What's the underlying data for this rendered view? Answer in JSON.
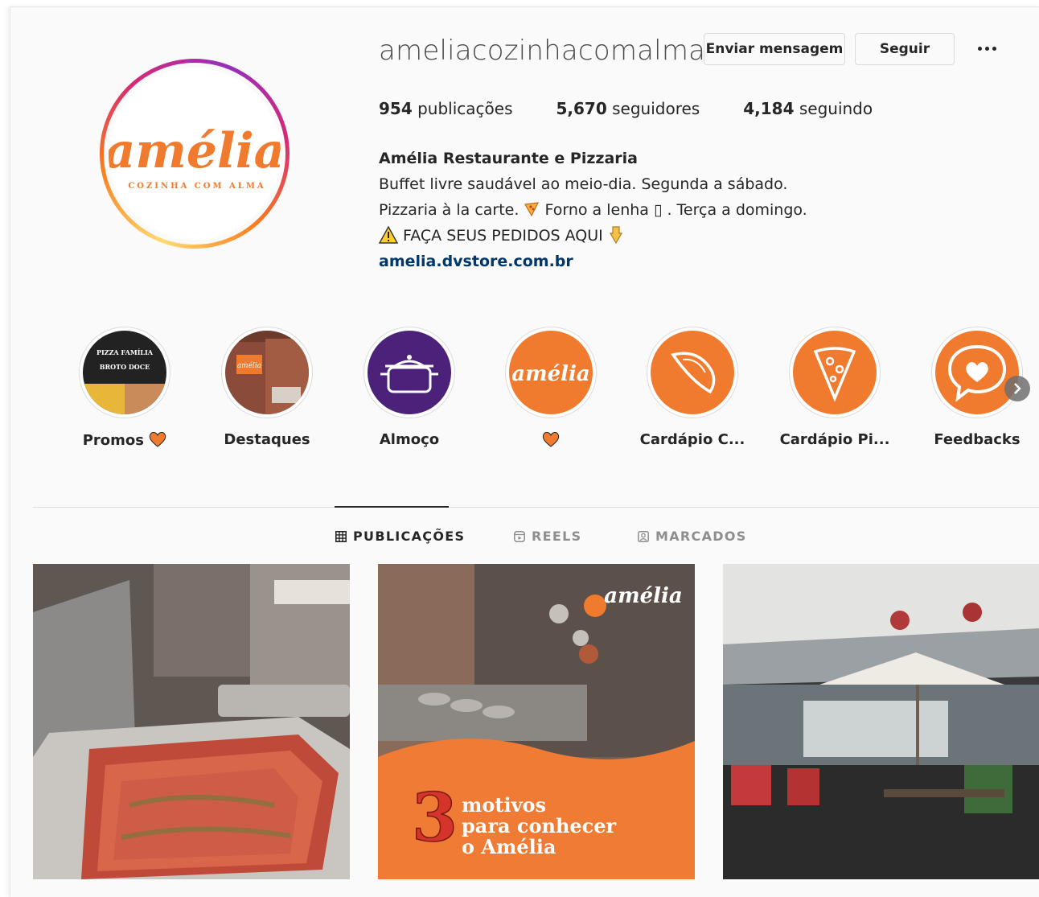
{
  "profile": {
    "username": "ameliacozinhacomalma",
    "message_button": "Enviar mensagem",
    "follow_button": "Seguir",
    "avatar_text": "amélia",
    "avatar_subtext": "COZINHA COM ALMA"
  },
  "stats": {
    "posts_count": "954",
    "posts_label": "publicações",
    "followers_count": "5,670",
    "followers_label": "seguidores",
    "following_count": "4,184",
    "following_label": "seguindo"
  },
  "bio": {
    "full_name": "Amélia Restaurante e Pizzaria",
    "line1": "Buffet livre saudável ao meio-dia. Segunda a sábado.",
    "line2_a": "Pizzaria à la carte. ",
    "line2_b": " Forno a lenha ▯ . Terça a domingo.",
    "line3": " FAÇA SEUS PEDIDOS AQUI ",
    "link": "amelia.dvstore.com.br"
  },
  "highlights": [
    {
      "label": "Promos",
      "icon": "heart-icon",
      "cover_text_1": "PIZZA FAMÍLIA",
      "cover_text_2": "BROTO DOCE"
    },
    {
      "label": "Destaques",
      "cover_text_1": "amélia"
    },
    {
      "label": "Almoço",
      "icon": "pot-icon"
    },
    {
      "label": "",
      "icon": "heart-icon",
      "cover_text_1": "amélia"
    },
    {
      "label": "Cardápio C...",
      "icon": "calzone-icon"
    },
    {
      "label": "Cardápio Pi...",
      "icon": "pizza-slice-icon"
    },
    {
      "label": "Feedbacks",
      "icon": "heart-bubble-icon"
    }
  ],
  "tabs": [
    {
      "label": "PUBLICAÇÕES",
      "icon": "grid-icon",
      "active": true
    },
    {
      "label": "REELS",
      "icon": "reels-icon",
      "active": false
    },
    {
      "label": "MARCADOS",
      "icon": "tagged-icon",
      "active": false
    }
  ],
  "posts": [
    {
      "kind": "photo",
      "subject": "buffet tray"
    },
    {
      "kind": "promo",
      "number": "3",
      "line1": "motivos",
      "line2": "para conhecer",
      "line3": "o Amélia",
      "logo": "amélia"
    },
    {
      "kind": "photo",
      "subject": "dining area"
    }
  ],
  "colors": {
    "brand_orange": "#f07a2d",
    "link": "#00376b",
    "highlight_purple": "#4b2179",
    "promo_orange": "#ef7b35"
  }
}
